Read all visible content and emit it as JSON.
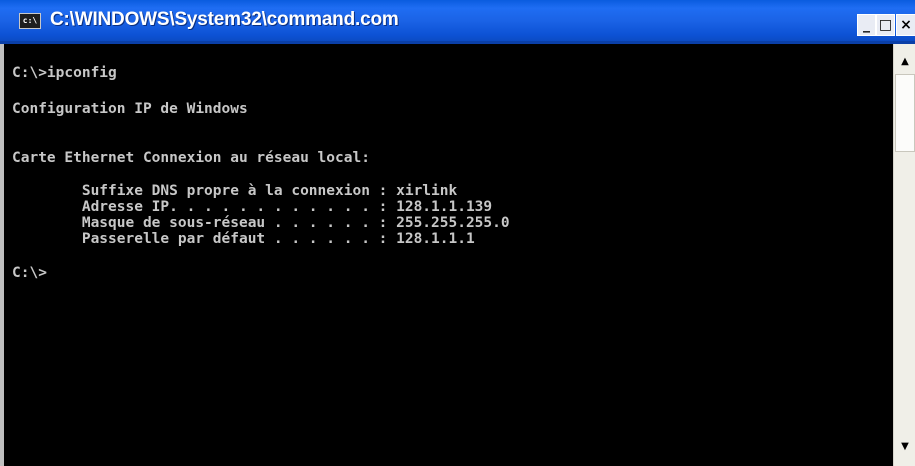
{
  "window": {
    "title": "C:\\WINDOWS\\System32\\command.com",
    "icon_label": "c:\\",
    "controls": {
      "minimize": "_",
      "maximize": "□",
      "close": "×"
    }
  },
  "console": {
    "lines": [
      "C:\\>ipconfig",
      "Configuration IP de Windows",
      "Carte Ethernet Connexion au réseau local:",
      "        Suffixe DNS propre à la connexion : xirlink",
      "        Adresse IP. . . . . . . . . . . . : 128.1.1.139",
      "        Masque de sous-réseau . . . . . . : 255.255.255.0",
      "        Passerelle par défaut . . . . . . : 128.1.1.1",
      "C:\\>"
    ]
  },
  "scrollbar": {
    "up_arrow": "▲",
    "down_arrow": "▼"
  }
}
